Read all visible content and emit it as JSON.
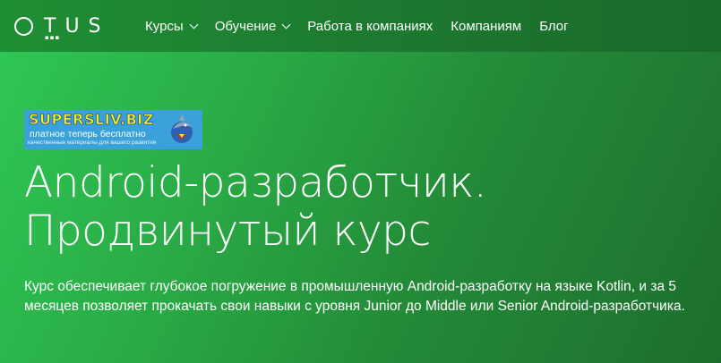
{
  "header": {
    "logo_text": "OTUS",
    "nav": [
      {
        "label": "Курсы",
        "has_dropdown": true
      },
      {
        "label": "Обучение",
        "has_dropdown": true
      },
      {
        "label": "Работа в компаниях",
        "has_dropdown": false
      },
      {
        "label": "Компаниям",
        "has_dropdown": false
      },
      {
        "label": "Блог",
        "has_dropdown": false
      }
    ]
  },
  "banner": {
    "title": "SUPERSLIV.BIZ",
    "subtitle": "платное теперь бесплатно",
    "tagline": "качественные материалы для вашего развития"
  },
  "hero": {
    "title_line1": "Android-разработчик.",
    "title_line2": "Продвинутый курс",
    "description": "Курс обеспечивает глубокое погружение в промышленную Android-разработку на языке Kotlin, и за 5 месяцев позволяет прокачать свои навыки с уровня Junior до Middle или Senior Android-разработчика."
  },
  "colors": {
    "hero_gradient_start": "#2fc955",
    "hero_gradient_end": "#1d6e2c",
    "header_bg": "#1d7a30",
    "banner_bg": "#3aa1da",
    "banner_title": "#f3f01e",
    "text": "#ffffff"
  }
}
